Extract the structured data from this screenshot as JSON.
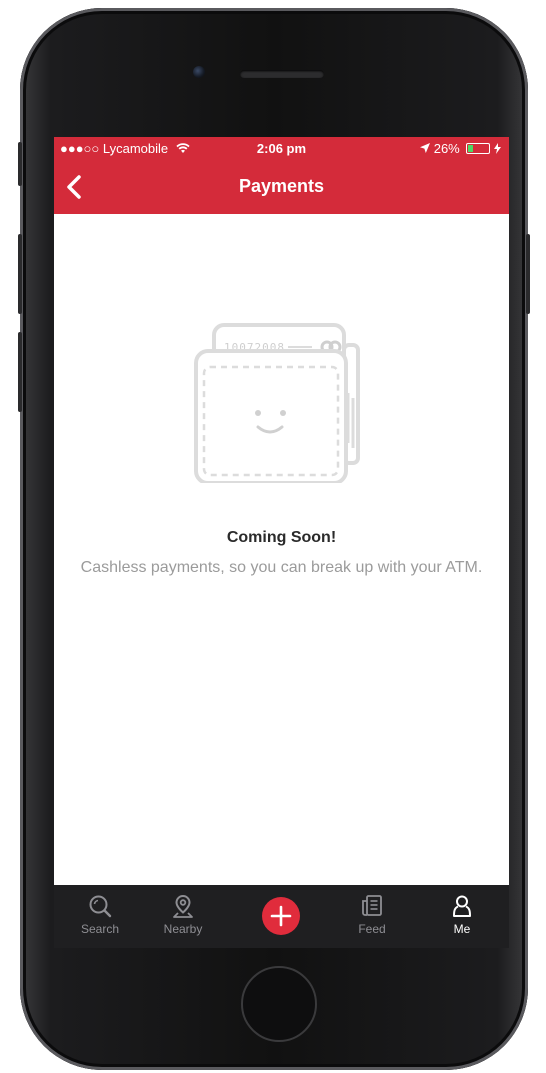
{
  "status_bar": {
    "carrier": "●●●○○ Lycamobile",
    "time": "2:06 pm",
    "battery_percent": "26%",
    "battery_level": 0.26
  },
  "nav": {
    "title": "Payments"
  },
  "empty_state": {
    "card_number": "10072008",
    "title": "Coming Soon!",
    "body": "Cashless payments, so you can break up with your ATM."
  },
  "tabs": [
    {
      "label": "Search",
      "icon": "search-icon",
      "active": false
    },
    {
      "label": "Nearby",
      "icon": "location-pin-icon",
      "active": false
    },
    {
      "label": "",
      "icon": "plus-icon",
      "active": false
    },
    {
      "label": "Feed",
      "icon": "feed-icon",
      "active": false
    },
    {
      "label": "Me",
      "icon": "person-icon",
      "active": true
    }
  ],
  "colors": {
    "brand_red": "#d42b3a",
    "tab_bar_bg": "#1f1f21",
    "battery_green": "#4cd964"
  }
}
